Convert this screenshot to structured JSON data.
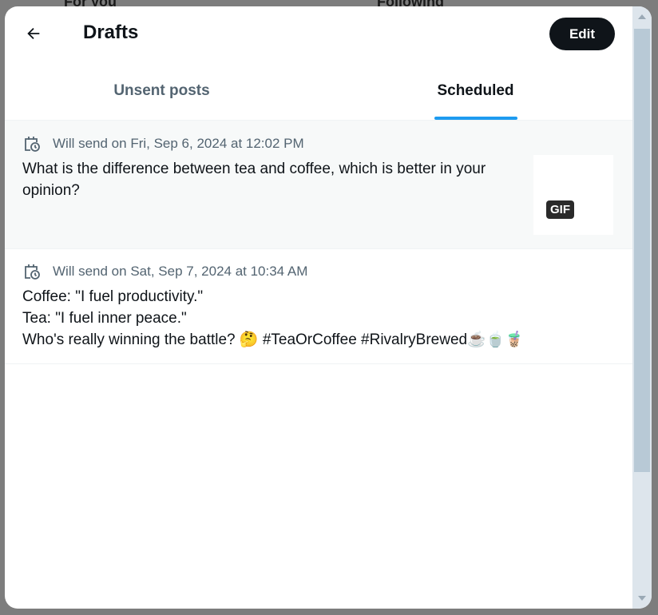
{
  "background": {
    "tabs": [
      "For you",
      "Following"
    ]
  },
  "header": {
    "title": "Drafts",
    "edit_label": "Edit",
    "back_icon": "arrow-left-icon"
  },
  "tabs": [
    {
      "label": "Unsent posts",
      "active": false
    },
    {
      "label": "Scheduled",
      "active": true
    }
  ],
  "posts": [
    {
      "schedule": "Will send on Fri, Sep 6, 2024 at 12:02 PM",
      "text": "What is the difference between tea and coffee, which is better in your opinion?",
      "media_badge": "GIF"
    },
    {
      "schedule": "Will send on Sat, Sep 7, 2024 at 10:34 AM",
      "lines": [
        "Coffee: \"I fuel productivity.\"",
        "Tea: \"I fuel inner peace.\"",
        "Who's really winning the battle? 🤔 #TeaOrCoffee #RivalryBrewed☕🍵🧋"
      ]
    }
  ],
  "colors": {
    "accent": "#1d9bf0",
    "text": "#0f1419",
    "secondary": "#536471"
  }
}
